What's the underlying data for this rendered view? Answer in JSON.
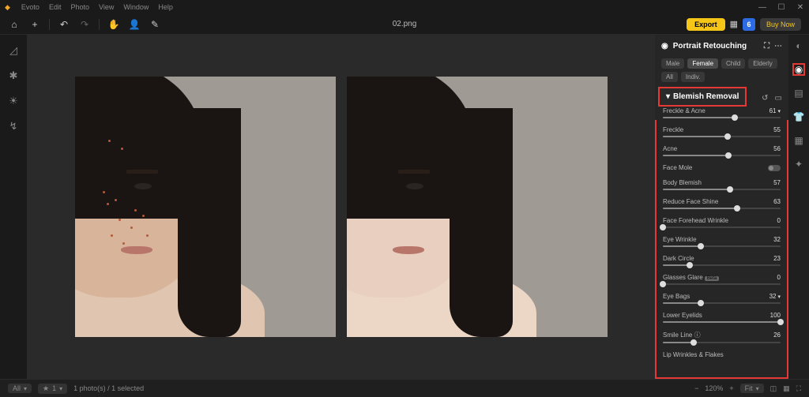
{
  "titlebar": {
    "app": "Evoto",
    "menu": [
      "Edit",
      "Photo",
      "View",
      "Window",
      "Help"
    ]
  },
  "toolbar": {
    "filename": "02.png",
    "export": "Export",
    "buynow": "Buy Now",
    "credits": "6"
  },
  "panel": {
    "title": "Portrait Retouching",
    "tabs": [
      "Male",
      "Female",
      "Child",
      "Elderly",
      "All",
      "Indiv."
    ],
    "active_tab": 1,
    "section": "Blemish Removal",
    "sliders": [
      {
        "name": "Freckle & Acne",
        "value": 61,
        "caret": true
      },
      {
        "name": "Freckle",
        "value": 55
      },
      {
        "name": "Acne",
        "value": 56
      },
      {
        "name": "Face Mole",
        "value": null,
        "toggle": true
      },
      {
        "name": "Body Blemish",
        "value": 57
      },
      {
        "name": "Reduce Face Shine",
        "value": 63
      },
      {
        "name": "Face Forehead Wrinkle",
        "value": 0
      },
      {
        "name": "Eye Wrinkle",
        "value": 32
      },
      {
        "name": "Dark Circle",
        "value": 23
      },
      {
        "name": "Glasses Glare",
        "value": 0,
        "beta": "Beta"
      },
      {
        "name": "Eye Bags",
        "value": 32,
        "caret": true
      },
      {
        "name": "Lower Eyelids",
        "value": 100
      },
      {
        "name": "Smile Line",
        "value": 26,
        "info": true
      },
      {
        "name": "Lip Wrinkles & Flakes",
        "value": null
      }
    ]
  },
  "statusbar": {
    "filter": "All",
    "rating": "1",
    "selection": "1 photo(s) / 1 selected",
    "zoom": "120%",
    "fit": "Fit"
  }
}
